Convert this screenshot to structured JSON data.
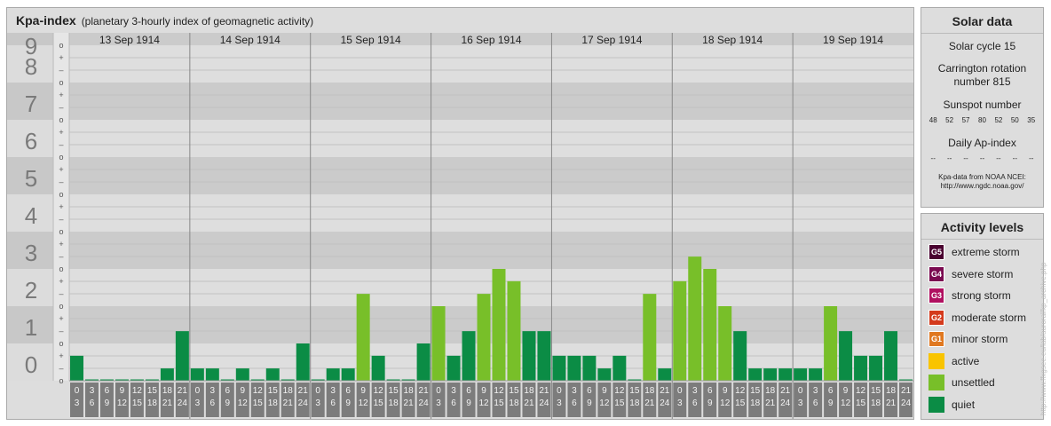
{
  "title": {
    "main": "Kpa-index",
    "subtitle": "(planetary 3-hourly index of geomagnetic activity)"
  },
  "chart_data": {
    "type": "bar",
    "ylim": [
      0,
      9
    ],
    "y_ticks": [
      "0",
      "1",
      "2",
      "3",
      "4",
      "5",
      "6",
      "7",
      "8",
      "9"
    ],
    "third_marks": [
      "o",
      "–",
      "+"
    ],
    "days": [
      "13 Sep 1914",
      "14 Sep 1914",
      "15 Sep 1914",
      "16 Sep 1914",
      "17 Sep 1914",
      "18 Sep 1914",
      "19 Sep 1914"
    ],
    "intervals": [
      [
        "0",
        "3"
      ],
      [
        "3",
        "6"
      ],
      [
        "6",
        "9"
      ],
      [
        "9",
        "12"
      ],
      [
        "12",
        "15"
      ],
      [
        "15",
        "18"
      ],
      [
        "18",
        "21"
      ],
      [
        "21",
        "24"
      ]
    ],
    "values": [
      [
        0.67,
        0,
        0,
        0,
        0,
        0,
        0.33,
        1.33
      ],
      [
        0.33,
        0.33,
        0,
        0.33,
        0,
        0.33,
        0,
        1
      ],
      [
        0,
        0.33,
        0.33,
        2.33,
        0.67,
        0,
        0,
        1
      ],
      [
        2,
        0.67,
        1.33,
        2.33,
        3,
        2.67,
        1.33,
        1.33
      ],
      [
        0.67,
        0.67,
        0.67,
        0.33,
        0.67,
        0,
        2.33,
        0.33
      ],
      [
        2.67,
        3.33,
        3,
        2,
        1.33,
        0.33,
        0.33,
        0.33
      ],
      [
        0.33,
        0.33,
        2,
        1.33,
        0.67,
        0.67,
        1.33,
        0
      ]
    ],
    "levels": {
      "quiet": "#0b8c45",
      "unsettled": "#78bf29",
      "active": "#f9c400",
      "g1": "#e07820",
      "g2": "#d43a1c",
      "g3": "#b01060",
      "g4": "#7a0a50",
      "g5": "#4a0030"
    }
  },
  "solar": {
    "title": "Solar data",
    "cycle": "Solar cycle 15",
    "carrington_line1": "Carrington rotation",
    "carrington_line2": "number 815",
    "sunspot_title": "Sunspot number",
    "sunspots": [
      "48",
      "52",
      "57",
      "80",
      "52",
      "50",
      "35"
    ],
    "ap_title": "Daily Ap-index",
    "ap_values": [
      "--",
      "--",
      "--",
      "--",
      "--",
      "--",
      "--"
    ],
    "credit_line1": "Kpa-data from NOAA NCEI:",
    "credit_line2": "http://www.ngdc.noaa.gov/"
  },
  "activity": {
    "title": "Activity levels",
    "items": [
      {
        "code": "G5",
        "label": "extreme storm",
        "color": "#4a0030",
        "icon": "g5-badge"
      },
      {
        "code": "G4",
        "label": "severe storm",
        "color": "#7a0a50",
        "icon": "g4-badge"
      },
      {
        "code": "G3",
        "label": "strong storm",
        "color": "#b01060",
        "icon": "g3-badge"
      },
      {
        "code": "G2",
        "label": "moderate storm",
        "color": "#d43a1c",
        "icon": "g2-badge"
      },
      {
        "code": "G1",
        "label": "minor storm",
        "color": "#e07820",
        "icon": "g1-badge"
      },
      {
        "code": "",
        "label": "active",
        "color": "#f9c400",
        "icon": "active-swatch"
      },
      {
        "code": "",
        "label": "unsettled",
        "color": "#78bf29",
        "icon": "unsettled-swatch"
      },
      {
        "code": "",
        "label": "quiet",
        "color": "#0b8c45",
        "icon": "quiet-swatch"
      }
    ]
  },
  "watermark": "http://www.ffxgsee.eu/lab/auroral/kp_archive.php"
}
